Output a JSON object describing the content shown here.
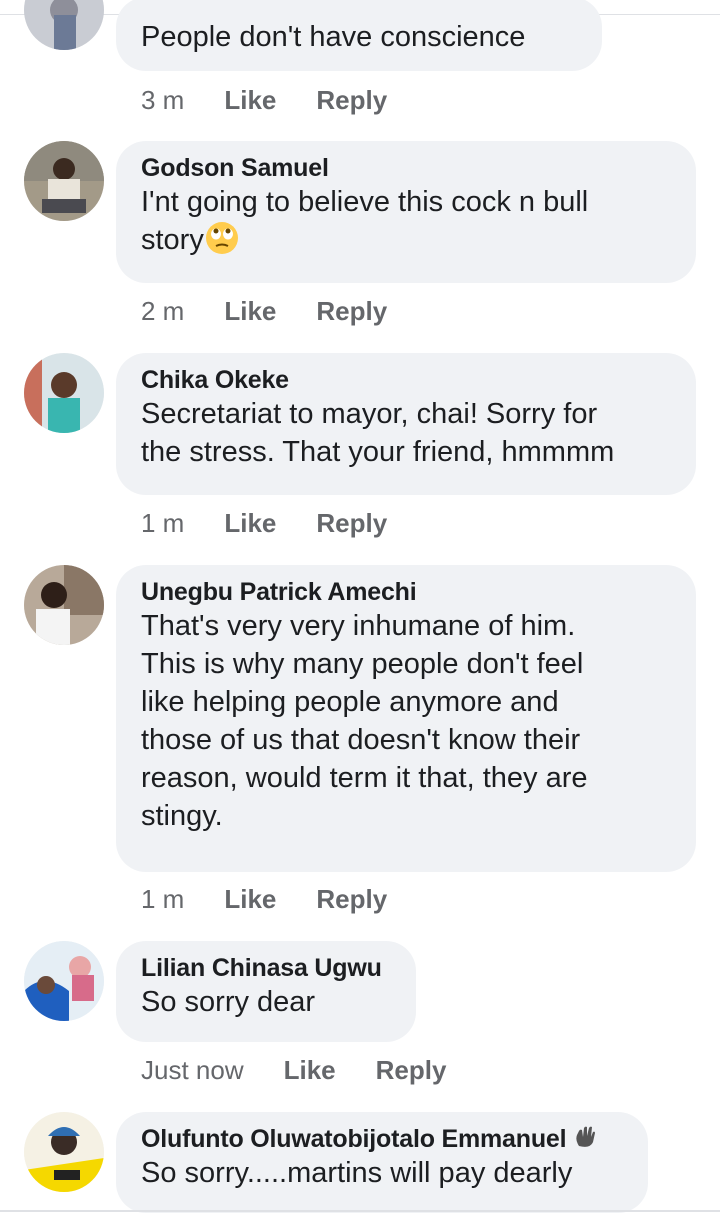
{
  "comments": [
    {
      "text": "People don't have conscience",
      "time": "3 m",
      "like": "Like",
      "reply": "Reply"
    },
    {
      "name": "Godson Samuel",
      "text": "I'nt going to believe this cock n bull\nstory",
      "emoji": "eye-roll-emoji",
      "time": "2 m",
      "like": "Like",
      "reply": "Reply"
    },
    {
      "name": "Chika Okeke",
      "text": "Secretariat to mayor, chai! Sorry for\nthe stress. That your friend, hmmmm",
      "time": "1 m",
      "like": "Like",
      "reply": "Reply"
    },
    {
      "name": "Unegbu Patrick Amechi",
      "text": "That's very very inhumane of him.\nThis is why many people don't feel\nlike helping people anymore and\nthose of us that doesn't know their\nreason, would term it that, they are\nstingy.",
      "time": "1 m",
      "like": "Like",
      "reply": "Reply"
    },
    {
      "name": "Lilian Chinasa Ugwu",
      "text": "So sorry dear",
      "time": "Just now",
      "like": "Like",
      "reply": "Reply"
    },
    {
      "name": "Olufunto Oluwatobijotalo Emmanuel",
      "badge": "waving-hand-icon",
      "text": "So sorry.....martins will pay dearly"
    }
  ],
  "colors": {
    "bubble": "#f0f2f5",
    "meta_text": "#65676b",
    "name_text": "#1c1e21"
  }
}
